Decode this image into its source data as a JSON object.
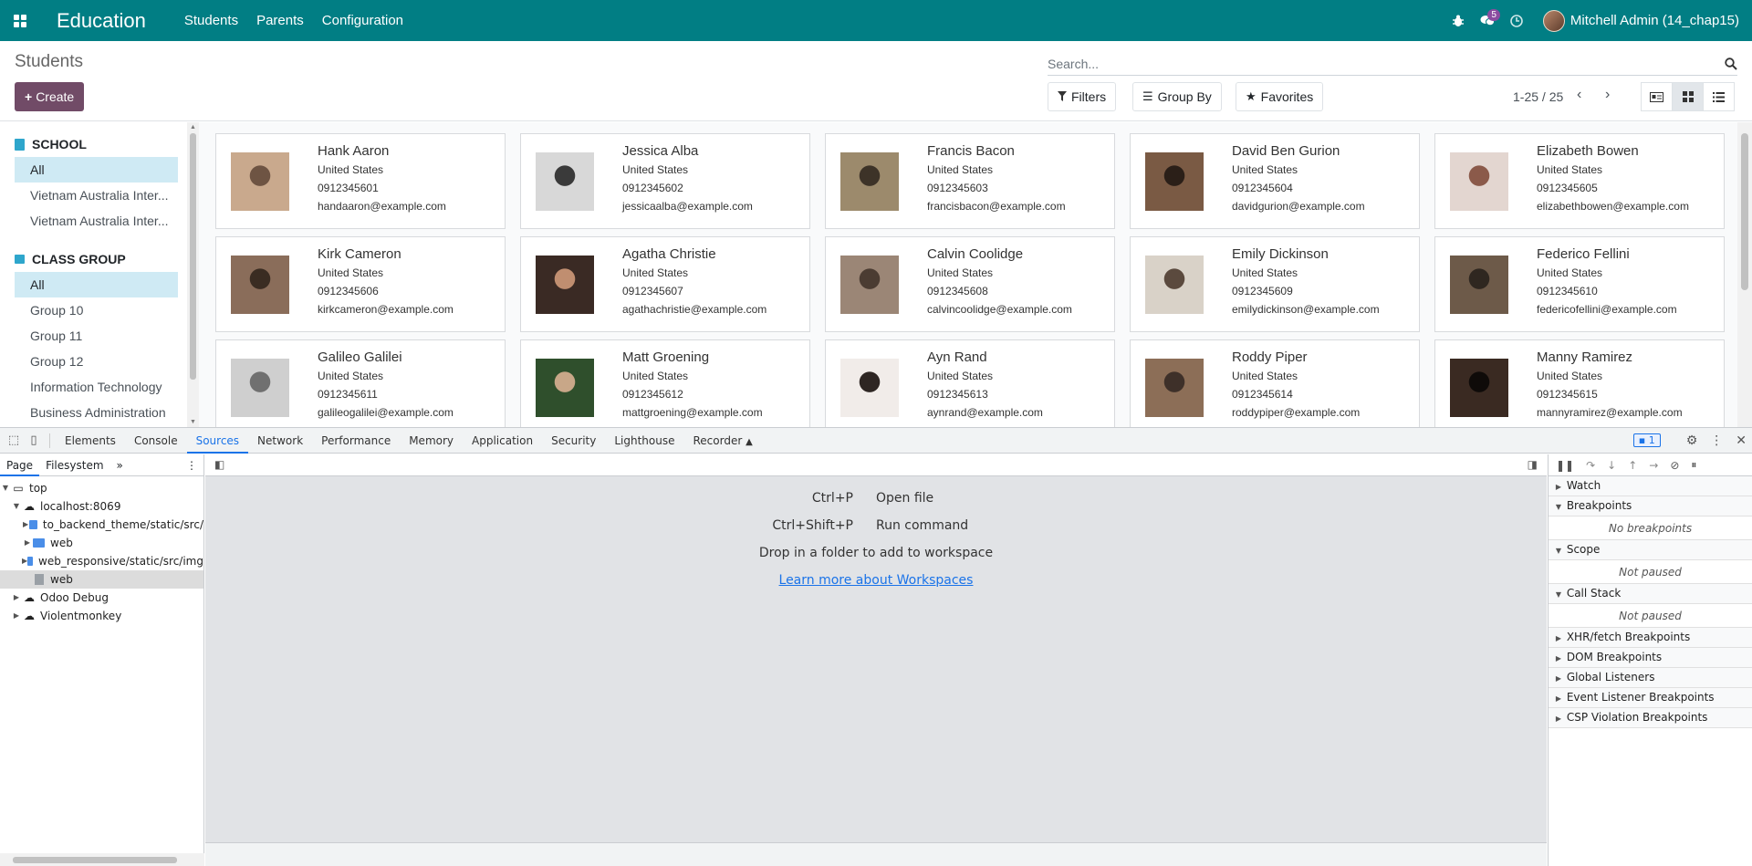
{
  "navbar": {
    "brand": "Education",
    "menus": [
      "Students",
      "Parents",
      "Configuration"
    ],
    "message_count": "5",
    "user_name": "Mitchell Admin (14_chap15)"
  },
  "control": {
    "breadcrumb": "Students",
    "create_label": "Create",
    "search_placeholder": "Search...",
    "filters_label": "Filters",
    "groupby_label": "Group By",
    "favorites_label": "Favorites",
    "pager": "1-25 / 25"
  },
  "sidebar": {
    "school_title": "SCHOOL",
    "school_items": [
      "All",
      "Vietnam Australia Inter...",
      "Vietnam Australia Inter..."
    ],
    "class_title": "CLASS GROUP",
    "class_items": [
      "All",
      "Group 10",
      "Group 11",
      "Group 12",
      "Information Technology",
      "Business Administration"
    ]
  },
  "students": [
    {
      "name": "Hank Aaron",
      "country": "United States",
      "phone": "0912345601",
      "email": "handaaron@example.com"
    },
    {
      "name": "Jessica Alba",
      "country": "United States",
      "phone": "0912345602",
      "email": "jessicaalba@example.com"
    },
    {
      "name": "Francis Bacon",
      "country": "United States",
      "phone": "0912345603",
      "email": "francisbacon@example.com"
    },
    {
      "name": "David Ben Gurion",
      "country": "United States",
      "phone": "0912345604",
      "email": "davidgurion@example.com"
    },
    {
      "name": "Elizabeth Bowen",
      "country": "United States",
      "phone": "0912345605",
      "email": "elizabethbowen@example.com"
    },
    {
      "name": "Kirk Cameron",
      "country": "United States",
      "phone": "0912345606",
      "email": "kirkcameron@example.com"
    },
    {
      "name": "Agatha Christie",
      "country": "United States",
      "phone": "0912345607",
      "email": "agathachristie@example.com"
    },
    {
      "name": "Calvin Coolidge",
      "country": "United States",
      "phone": "0912345608",
      "email": "calvincoolidge@example.com"
    },
    {
      "name": "Emily Dickinson",
      "country": "United States",
      "phone": "0912345609",
      "email": "emilydickinson@example.com"
    },
    {
      "name": "Federico Fellini",
      "country": "United States",
      "phone": "0912345610",
      "email": "federicofellini@example.com"
    },
    {
      "name": "Galileo Galilei",
      "country": "United States",
      "phone": "0912345611",
      "email": "galileogalilei@example.com"
    },
    {
      "name": "Matt Groening",
      "country": "United States",
      "phone": "0912345612",
      "email": "mattgroening@example.com"
    },
    {
      "name": "Ayn Rand",
      "country": "United States",
      "phone": "0912345613",
      "email": "aynrand@example.com"
    },
    {
      "name": "Roddy Piper",
      "country": "United States",
      "phone": "0912345614",
      "email": "roddypiper@example.com"
    },
    {
      "name": "Manny Ramirez",
      "country": "United States",
      "phone": "0912345615",
      "email": "mannyramirez@example.com"
    }
  ],
  "devtools": {
    "tabs": [
      "Elements",
      "Console",
      "Sources",
      "Network",
      "Performance",
      "Memory",
      "Application",
      "Security",
      "Lighthouse",
      "Recorder"
    ],
    "active_tab": "Sources",
    "issues_count": "1",
    "nav_tabs": [
      "Page",
      "Filesystem"
    ],
    "tree": {
      "top": "top",
      "host": "localhost:8069",
      "folders": [
        "to_backend_theme/static/src/",
        "web",
        "web_responsive/static/src/img"
      ],
      "file": "web",
      "others": [
        "Odoo Debug",
        "Violentmonkey"
      ]
    },
    "shortcuts": [
      {
        "key": "Ctrl+P",
        "action": "Open file"
      },
      {
        "key": "Ctrl+Shift+P",
        "action": "Run command"
      }
    ],
    "drop_text": "Drop in a folder to add to workspace",
    "learn_link": "Learn more about Workspaces",
    "debug_sections": {
      "watch": "Watch",
      "breakpoints": "Breakpoints",
      "no_breakpoints": "No breakpoints",
      "scope": "Scope",
      "not_paused_1": "Not paused",
      "call_stack": "Call Stack",
      "not_paused_2": "Not paused",
      "xhr": "XHR/fetch Breakpoints",
      "dom": "DOM Breakpoints",
      "global": "Global Listeners",
      "event": "Event Listener Breakpoints",
      "csp": "CSP Violation Breakpoints"
    }
  },
  "colors": {
    "navbar": "#017e84",
    "create_button": "#714b67",
    "active_filter": "#cfeaf4",
    "devtools_accent": "#1a73e8"
  }
}
